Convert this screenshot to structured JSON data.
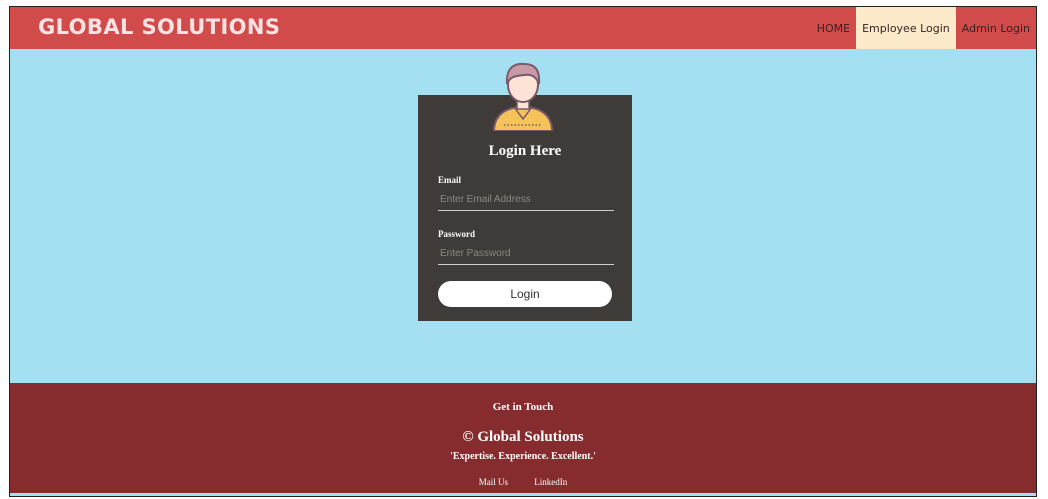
{
  "brand": "GLOBAL SOLUTIONS",
  "nav": {
    "home": "HOME",
    "employee_login": "Employee Login",
    "admin_login": "Admin Login"
  },
  "login": {
    "title": "Login Here",
    "email_label": "Email",
    "email_placeholder": "Enter Email Address",
    "password_label": "Password",
    "password_placeholder": "Enter Password",
    "button": "Login"
  },
  "footer": {
    "get_in_touch": "Get in Touch",
    "copyright": "© Global Solutions",
    "tagline": "'Expertise. Experience. Excellent.'",
    "links": [
      "Mail Us",
      "LinkedIn"
    ]
  },
  "colors": {
    "navbar": "#d24b4b",
    "active_tab": "#fdeacb",
    "background": "#a4e0f1",
    "login_box": "#3f3b38",
    "footer": "#862c2f"
  },
  "icons": {
    "avatar": "user-avatar-icon"
  }
}
